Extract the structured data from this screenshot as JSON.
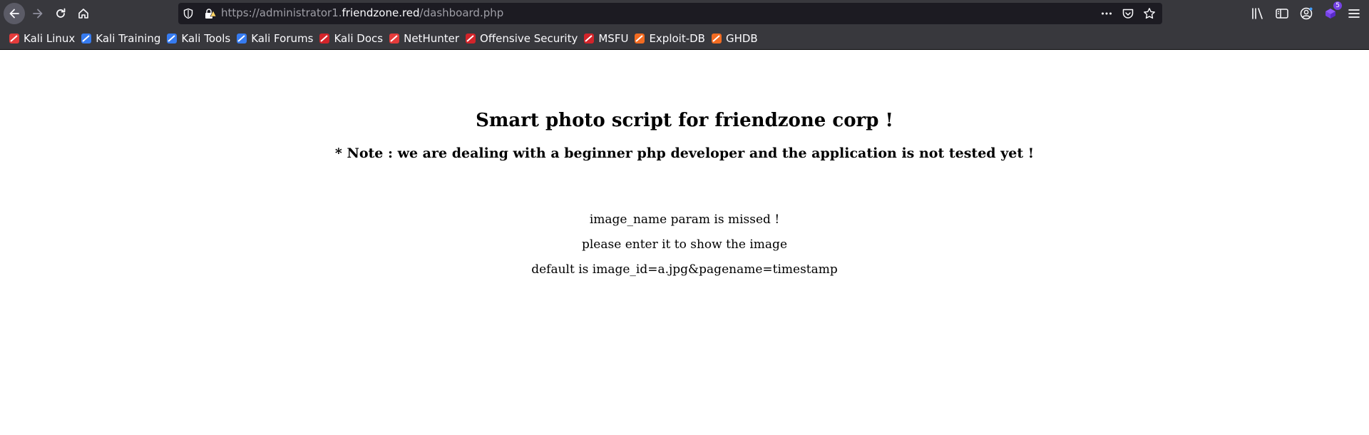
{
  "browser": {
    "url": {
      "prefix": "https://administrator1.",
      "host": "friendzone.red",
      "path": "/dashboard.php"
    },
    "extension_badge": "5",
    "bookmarks": [
      {
        "label": "Kali Linux",
        "icon": "kali-icon",
        "color": "#e43b3b"
      },
      {
        "label": "Kali Training",
        "icon": "kali-training-icon",
        "color": "#367bf0"
      },
      {
        "label": "Kali Tools",
        "icon": "kali-tools-icon",
        "color": "#367bf0"
      },
      {
        "label": "Kali Forums",
        "icon": "kali-forums-icon",
        "color": "#367bf0"
      },
      {
        "label": "Kali Docs",
        "icon": "kali-docs-icon",
        "color": "#d2242a"
      },
      {
        "label": "NetHunter",
        "icon": "nethunter-icon",
        "color": "#e43b3b"
      },
      {
        "label": "Offensive Security",
        "icon": "offsec-icon",
        "color": "#d2242a"
      },
      {
        "label": "MSFU",
        "icon": "msfu-icon",
        "color": "#d2242a"
      },
      {
        "label": "Exploit-DB",
        "icon": "exploitdb-icon",
        "color": "#f26b21"
      },
      {
        "label": "GHDB",
        "icon": "ghdb-icon",
        "color": "#f26b21"
      }
    ]
  },
  "page": {
    "heading": "Smart photo script for friendzone corp !",
    "note": "* Note : we are dealing with a beginner php developer and the application is not tested yet !",
    "lines": [
      "image_name param is missed !",
      "please enter it to show the image",
      "default is image_id=a.jpg&pagename=timestamp"
    ]
  }
}
